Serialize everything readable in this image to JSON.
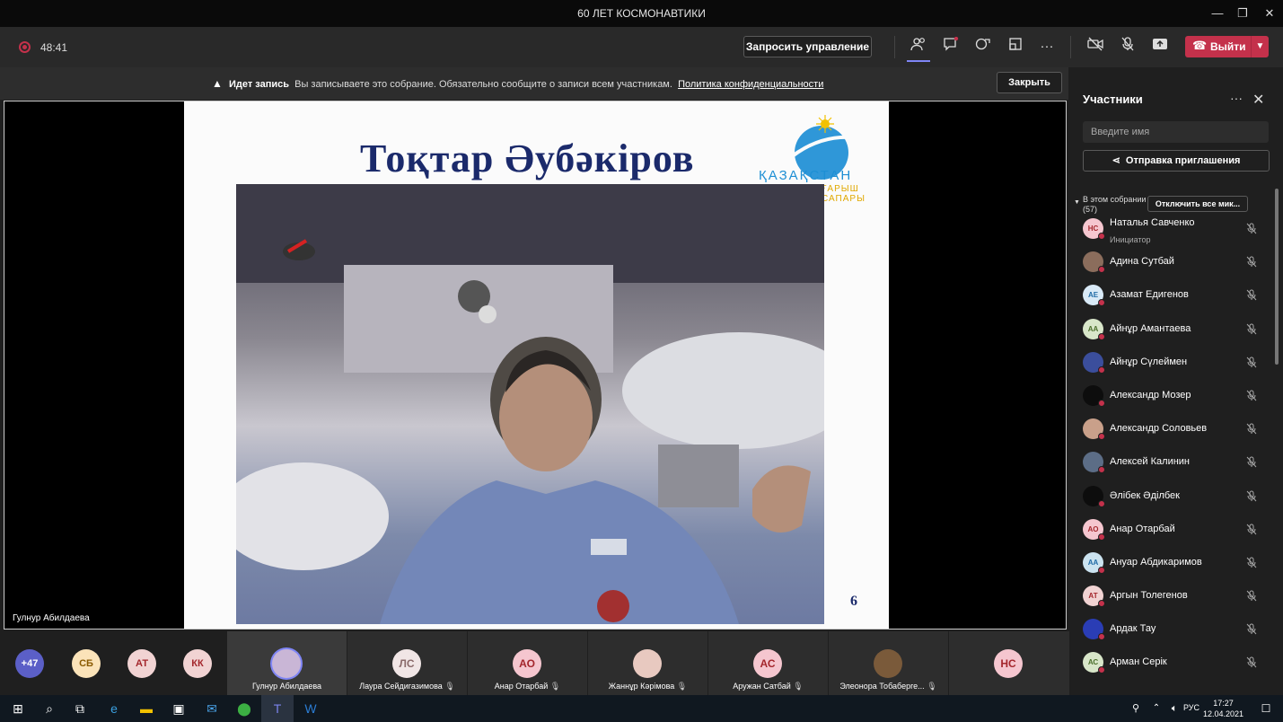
{
  "window": {
    "title": "60 ЛЕТ КОСМОНАВТИКИ"
  },
  "toolbar": {
    "timer": "48:41",
    "request_control": "Запросить управление",
    "leave": "Выйти"
  },
  "banner": {
    "bold": "Идет запись",
    "text": "Вы записываете это собрание. Обязательно сообщите о записи всем участникам.",
    "link": "Политика конфиденциальности",
    "close": "Закрыть"
  },
  "stage": {
    "presenter": "Гулнур Абилдаева",
    "slide_title": "Тоқтар Әубәкіров",
    "logo_text": "ҚАЗАҚСТАН",
    "logo_sub": "ҒАРЫШ САПАРЫ",
    "slide_number": "6"
  },
  "sidebar": {
    "title": "Участники",
    "search_placeholder": "Введите имя",
    "invite": "Отправка приглашения",
    "in_meeting": "В этом собрании",
    "count": "(57)",
    "mute_all": "Отключить все мик...",
    "participants": [
      {
        "initials": "НС",
        "name": "Наталья Савченко",
        "role": "Инициатор",
        "bg": "#f5c6cf",
        "fg": "#a4262c"
      },
      {
        "initials": "",
        "name": "Адина Сутбай",
        "role": "",
        "bg": "#8b6d5c",
        "fg": "#fff"
      },
      {
        "initials": "АЕ",
        "name": "Азамат Едигенов",
        "role": "",
        "bg": "#d9eaf7",
        "fg": "#1f6aa5"
      },
      {
        "initials": "АА",
        "name": "Айнұр Амантаева",
        "role": "",
        "bg": "#d8e6c9",
        "fg": "#4a6e2a"
      },
      {
        "initials": "",
        "name": "Айнұр Сүлеймен",
        "role": "",
        "bg": "#3b4e9c",
        "fg": "#fff"
      },
      {
        "initials": "",
        "name": "Александр Мозер",
        "role": "",
        "bg": "#0d0d0d",
        "fg": "#fff"
      },
      {
        "initials": "",
        "name": "Александр Соловьев",
        "role": "",
        "bg": "#c9a08a",
        "fg": "#fff"
      },
      {
        "initials": "",
        "name": "Алексей Калинин",
        "role": "",
        "bg": "#5c6d86",
        "fg": "#fff"
      },
      {
        "initials": "",
        "name": "Әлібек Әділбек",
        "role": "",
        "bg": "#0d0d0d",
        "fg": "#fff"
      },
      {
        "initials": "АО",
        "name": "Анар Отарбай",
        "role": "",
        "bg": "#f5c6cf",
        "fg": "#a4262c"
      },
      {
        "initials": "АА",
        "name": "Ануар Абдикаримов",
        "role": "",
        "bg": "#cbe3f0",
        "fg": "#1f6aa5"
      },
      {
        "initials": "АТ",
        "name": "Аргын Толегенов",
        "role": "",
        "bg": "#f1d3d3",
        "fg": "#a4262c"
      },
      {
        "initials": "",
        "name": "Ардак Тау",
        "role": "",
        "bg": "#2a3db5",
        "fg": "#fff"
      },
      {
        "initials": "АС",
        "name": "Арман Серік",
        "role": "",
        "bg": "#d8e6c9",
        "fg": "#4a6e2a"
      }
    ]
  },
  "strip": {
    "overflow": "+47",
    "small": [
      {
        "initials": "СБ",
        "bg": "#fbe3b9",
        "fg": "#8a5a00"
      },
      {
        "initials": "АТ",
        "bg": "#f1d3d3",
        "fg": "#a4262c"
      },
      {
        "initials": "КК",
        "bg": "#f1d3d3",
        "fg": "#a4262c"
      }
    ],
    "tiles": [
      {
        "initials": "",
        "name": "Гулнур Абилдаева",
        "bg": "#c9b6d6",
        "fg": "#fff"
      },
      {
        "initials": "ЛС",
        "name": "Лаура Сейдигазимова",
        "bg": "#f1e6e6",
        "fg": "#8a6a6a"
      },
      {
        "initials": "АО",
        "name": "Анар Отарбай",
        "bg": "#f5c6cf",
        "fg": "#a4262c"
      },
      {
        "initials": "",
        "name": "Жаннұр Кәрімова",
        "bg": "#e8c9c0",
        "fg": "#fff"
      },
      {
        "initials": "АС",
        "name": "Аружан Сатбай",
        "bg": "#f5c6cf",
        "fg": "#a4262c"
      },
      {
        "initials": "",
        "name": "Элеонора Тобаберге...",
        "bg": "#7a5a3a",
        "fg": "#fff"
      },
      {
        "initials": "НС",
        "name": "",
        "bg": "#f5c6cf",
        "fg": "#a4262c"
      }
    ]
  },
  "taskbar": {
    "lang": "РУС",
    "time": "17:27",
    "date": "12.04.2021"
  }
}
